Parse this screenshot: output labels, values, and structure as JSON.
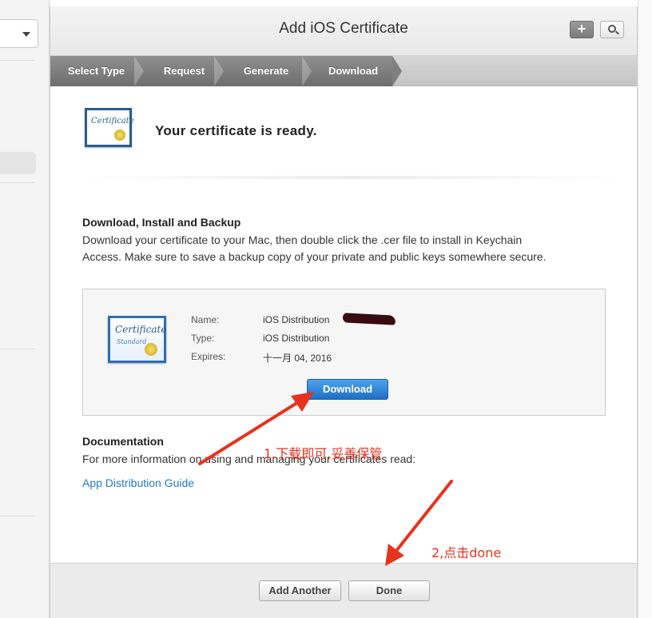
{
  "window": {
    "title": "Add iOS Certificate",
    "add_button": "+"
  },
  "steps": [
    {
      "label": "Select Type"
    },
    {
      "label": "Request"
    },
    {
      "label": "Generate"
    },
    {
      "label": "Download"
    }
  ],
  "header": {
    "icon_text": "Certificate",
    "title": "Your certificate is ready."
  },
  "install": {
    "title": "Download, Install and Backup",
    "line1": "Download your certificate to your Mac, then double click the .cer file to install in Keychain",
    "line2": "Access. Make sure to save a backup copy of your private and public keys somewhere secure."
  },
  "certificate": {
    "icon_text": "Certificate",
    "icon_subtext": "Standard",
    "name_label": "Name:",
    "name_value": "iOS Distribution",
    "type_label": "Type:",
    "type_value": "iOS Distribution",
    "expires_label": "Expires:",
    "expires_value": "十一月 04, 2016",
    "download_label": "Download"
  },
  "documentation": {
    "title": "Documentation",
    "text": "For more information on using and managing your certificates read:",
    "link": "App Distribution Guide"
  },
  "footer": {
    "add_another": "Add Another",
    "done": "Done"
  },
  "annotations": {
    "note1": "1,下载即可,妥善保管",
    "note2": "2,点击done",
    "color": "#e8321e"
  }
}
